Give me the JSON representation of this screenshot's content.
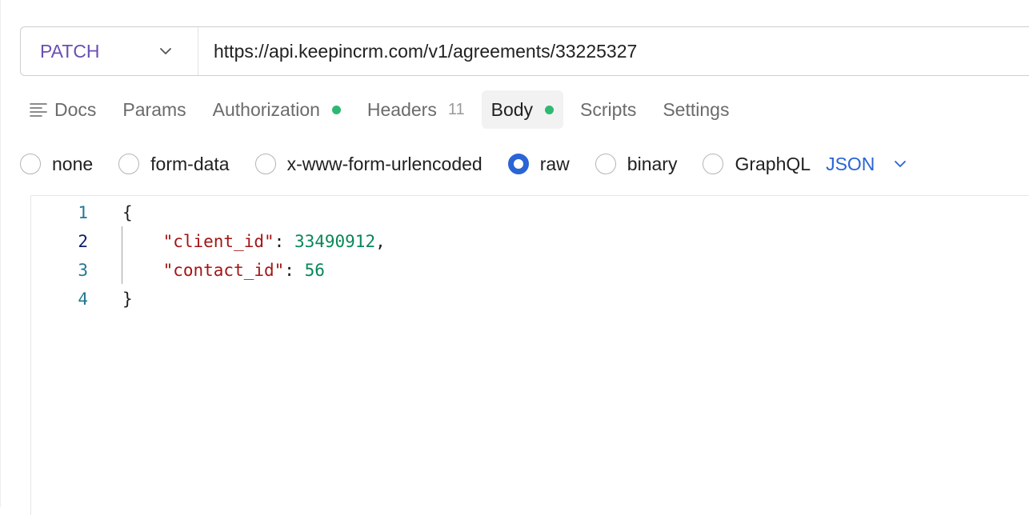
{
  "request": {
    "method": "PATCH",
    "url": "https://api.keepincrm.com/v1/agreements/33225327"
  },
  "tabs": [
    {
      "label": "Docs"
    },
    {
      "label": "Params"
    },
    {
      "label": "Authorization",
      "dot": true
    },
    {
      "label": "Headers",
      "count": "11"
    },
    {
      "label": "Body",
      "dot": true,
      "active": true
    },
    {
      "label": "Scripts"
    },
    {
      "label": "Settings"
    }
  ],
  "body_types": [
    {
      "label": "none",
      "checked": false
    },
    {
      "label": "form-data",
      "checked": false
    },
    {
      "label": "x-www-form-urlencoded",
      "checked": false
    },
    {
      "label": "raw",
      "checked": true
    },
    {
      "label": "binary",
      "checked": false
    },
    {
      "label": "GraphQL",
      "checked": false
    }
  ],
  "language": "JSON",
  "editor": {
    "lines": [
      {
        "n": "1",
        "text": "{"
      },
      {
        "n": "2",
        "key": "\"client_id\"",
        "sep": ": ",
        "value": "33490912",
        "trail": ","
      },
      {
        "n": "3",
        "key": "\"contact_id\"",
        "sep": ": ",
        "value": "56",
        "trail": ""
      },
      {
        "n": "4",
        "text": "}"
      }
    ]
  },
  "colors": {
    "method": "#6a4fb3",
    "accent": "#2a64d6",
    "status_dot": "#2eb872",
    "json_key": "#a31515",
    "json_number": "#098658"
  }
}
